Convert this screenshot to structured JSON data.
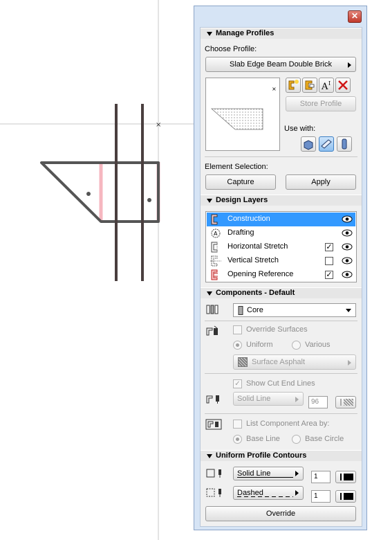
{
  "palette": {
    "close_label": "✕",
    "manage_profiles": {
      "title": "Manage Profiles",
      "choose_label": "Choose Profile:",
      "selected_profile": "Slab Edge Beam Double Brick",
      "store_profile": "Store Profile",
      "use_with": "Use with:",
      "element_selection": "Element Selection:",
      "capture": "Capture",
      "apply": "Apply",
      "tool_icons": [
        "new-profile-icon",
        "edit-profile-icon",
        "rename-profile-icon",
        "delete-profile-icon"
      ],
      "use_with_icons": [
        "wall-tool-icon",
        "beam-tool-icon",
        "column-tool-icon"
      ],
      "active_use_with": "beam-tool-icon"
    },
    "design_layers": {
      "title": "Design Layers",
      "items": [
        {
          "label": "Construction",
          "checkbox": null,
          "visible": true,
          "selected": true
        },
        {
          "label": "Drafting",
          "checkbox": null,
          "visible": true,
          "selected": false
        },
        {
          "label": "Horizontal Stretch",
          "checkbox": true,
          "visible": true,
          "selected": false
        },
        {
          "label": "Vertical Stretch",
          "checkbox": false,
          "visible": true,
          "selected": false
        },
        {
          "label": "Opening Reference",
          "checkbox": true,
          "visible": true,
          "selected": false
        }
      ]
    },
    "components": {
      "title": "Components - Default",
      "component": "Core",
      "override_surfaces": "Override Surfaces",
      "uniform": "Uniform",
      "various": "Various",
      "surface": "Surface Asphalt",
      "show_cut_end_lines": "Show Cut End Lines",
      "line_type": "Solid Line",
      "pen_number": "96",
      "list_area_by": "List Component Area by:",
      "base_line": "Base Line",
      "base_circle": "Base Circle"
    },
    "contours": {
      "title": "Uniform Profile Contours",
      "line1": "Solid Line",
      "pen1": "1",
      "line2": "Dashed",
      "pen2": "1",
      "override": "Override"
    }
  }
}
